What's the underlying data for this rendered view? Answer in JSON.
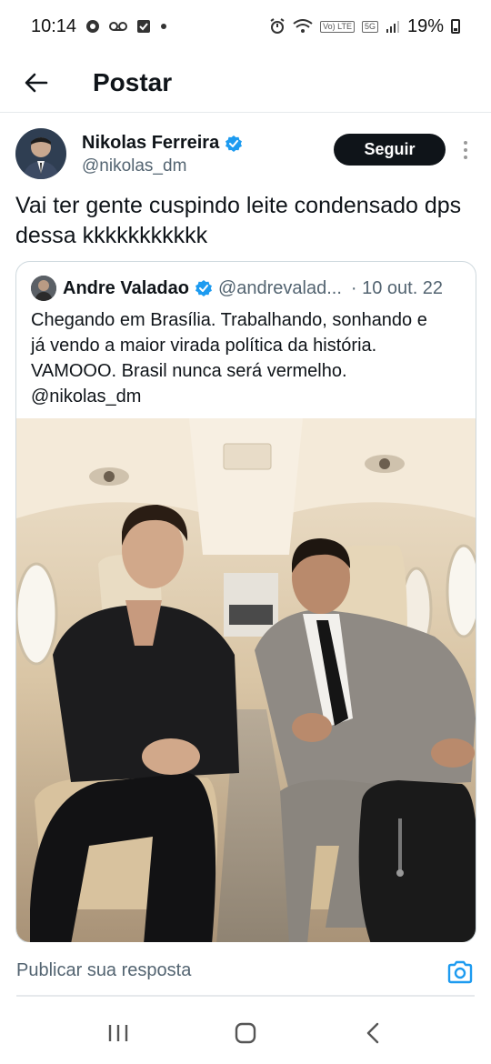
{
  "status_bar": {
    "time": "10:14",
    "battery_percent": "19%",
    "network_label": "5G",
    "volte_label": "Vo) LTE"
  },
  "header": {
    "title": "Postar",
    "back_icon": "arrow-left-icon"
  },
  "author": {
    "name": "Nikolas Ferreira",
    "handle": "@nikolas_dm",
    "verified": true,
    "follow_label": "Seguir"
  },
  "tweet": {
    "text": "Vai ter gente cuspindo leite condensado dps dessa kkkkkkkkkkk"
  },
  "quote": {
    "name": "Andre Valadao",
    "handle": "@andrevalad...",
    "date": "· 10 out. 22",
    "text": "Chegando em Brasília. Trabalhando, sonhando e\njá vendo a maior virada política da história.\nVAMOOO. Brasil nunca será vermelho.\n@nikolas_dm"
  },
  "reply": {
    "placeholder": "Publicar sua resposta",
    "camera_icon": "camera-icon"
  },
  "colors": {
    "accent": "#1d9bf0",
    "text_primary": "#0f1419",
    "text_secondary": "#536471",
    "border": "#cfd9de"
  }
}
